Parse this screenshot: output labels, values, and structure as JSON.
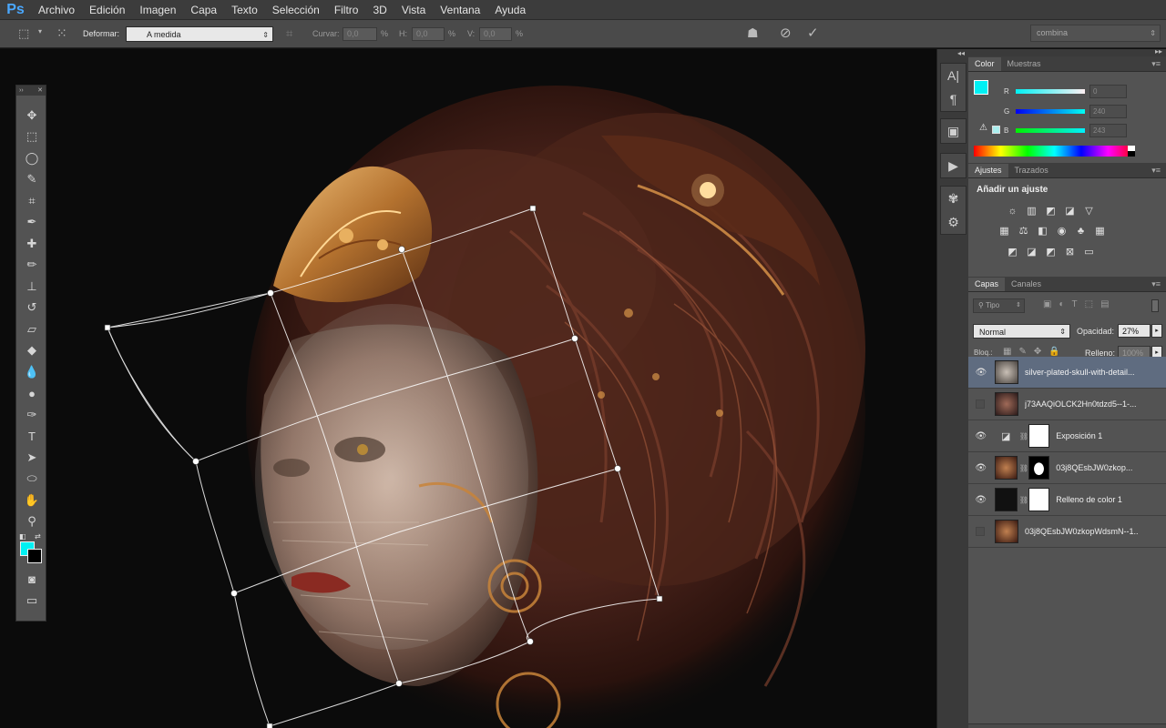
{
  "app": {
    "logo": "Ps"
  },
  "menu": [
    "Archivo",
    "Edición",
    "Imagen",
    "Capa",
    "Texto",
    "Selección",
    "Filtro",
    "3D",
    "Vista",
    "Ventana",
    "Ayuda"
  ],
  "options": {
    "warp_label": "Deformar:",
    "warp_value": "A medida",
    "bend_label": "Curvar:",
    "bend_value": "0,0",
    "h_label": "H:",
    "h_value": "0,0",
    "v_label": "V:",
    "v_value": "0,0",
    "percent": "%",
    "combo": "combina"
  },
  "color_panel": {
    "tabs": [
      "Color",
      "Muestras"
    ],
    "foreground": "#00f0f3",
    "background": "#000000",
    "r_label": "R",
    "g_label": "G",
    "b_label": "B",
    "r_value": "0",
    "g_value": "240",
    "b_value": "243"
  },
  "adjustments": {
    "tabs": [
      "Ajustes",
      "Trazados"
    ],
    "title": "Añadir un ajuste"
  },
  "layers": {
    "tabs": [
      "Capas",
      "Canales"
    ],
    "filter": "Tipo",
    "blend_mode": "Normal",
    "opacity_label": "Opacidad:",
    "opacity_value": "27%",
    "lock_label": "Bloq.:",
    "fill_label": "Relleno:",
    "fill_value": "100%",
    "items": [
      {
        "name": "silver-plated-skull-with-detail...",
        "visible": true,
        "selected": true
      },
      {
        "name": "j73AAQiOLCK2Hn0tdzd5--1-...",
        "visible": false,
        "selected": false
      },
      {
        "name": "Exposición 1",
        "visible": true,
        "selected": false
      },
      {
        "name": "03j8QEsbJW0zkop...",
        "visible": true,
        "selected": false
      },
      {
        "name": "Relleno de color 1",
        "visible": true,
        "selected": false
      },
      {
        "name": "03j8QEsbJW0zkopWdsmN--1...",
        "visible": false,
        "selected": false
      }
    ]
  }
}
